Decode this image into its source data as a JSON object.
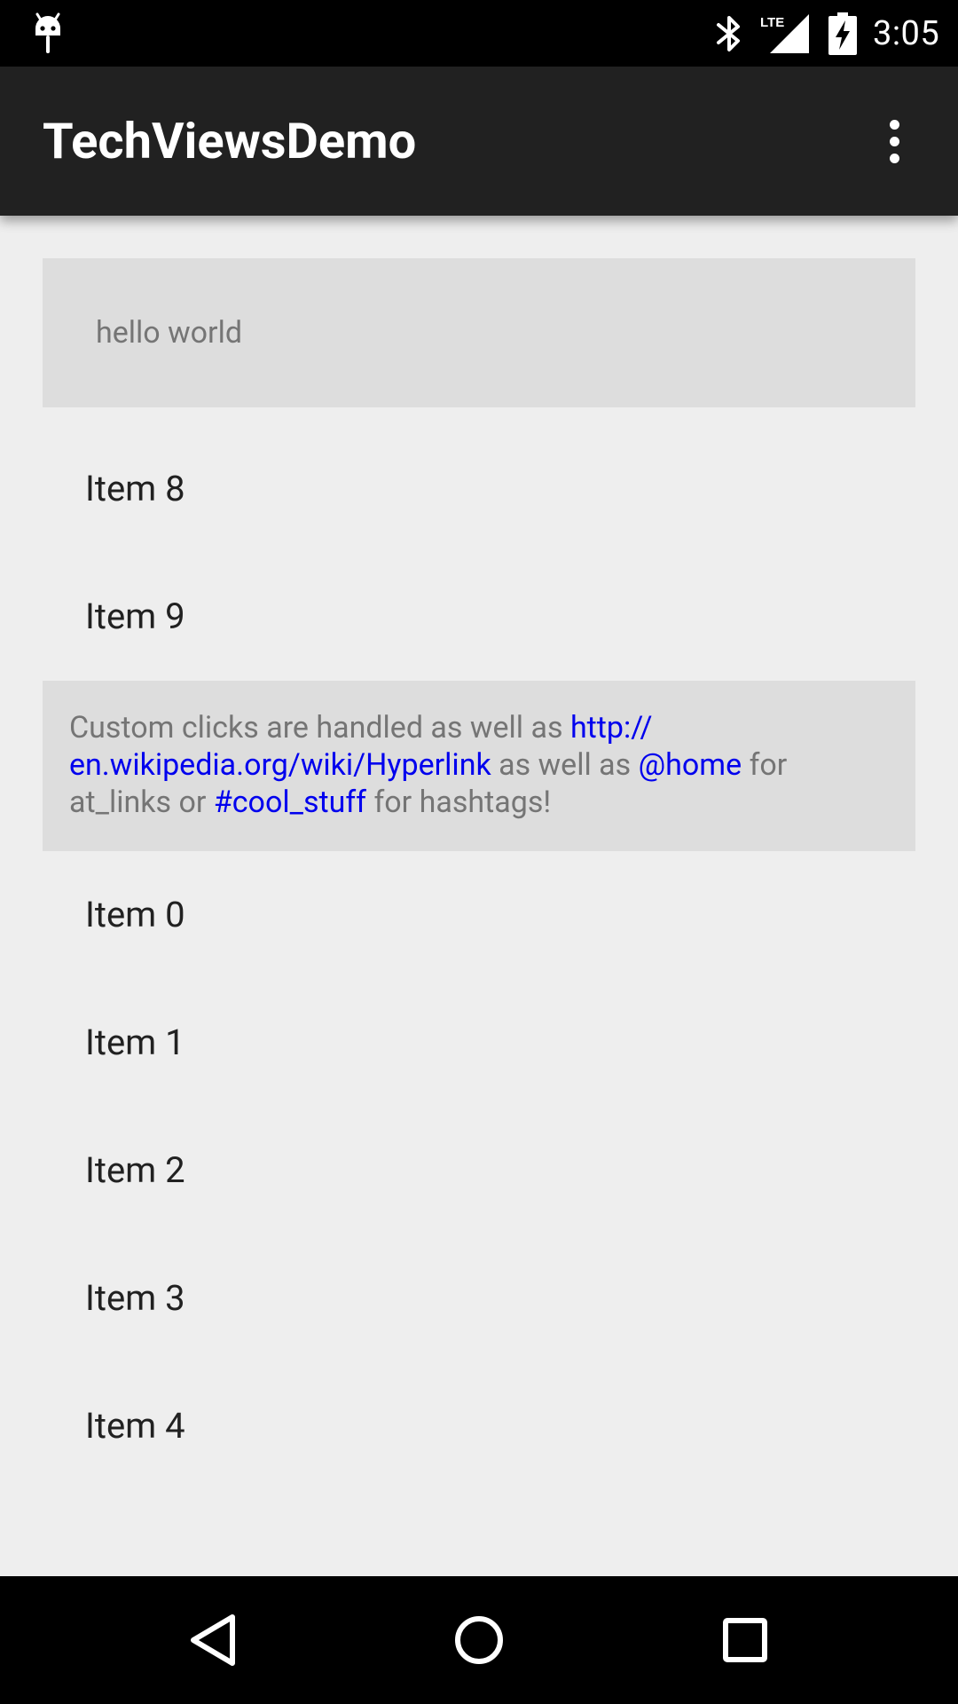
{
  "status_bar": {
    "time": "3:05",
    "network": "LTE",
    "icons": [
      "android-debug-icon",
      "bluetooth-icon",
      "signal-icon",
      "battery-charging-icon"
    ]
  },
  "toolbar": {
    "title": "TechViewsDemo",
    "menu_icon": "overflow-menu-icon"
  },
  "content": {
    "hello_text": "hello world",
    "items_top": [
      "Item 8",
      "Item 9"
    ],
    "link_text": {
      "p1": "Custom clicks are handled as well as ",
      "url_line1": "http://",
      "url_line2": "en.wikipedia.org/wiki/Hyperlink",
      "p2": " as well as ",
      "mention": "@home",
      "p3": " for at_links or ",
      "hashtag": "#cool_stuff",
      "p4": " for hashtags!"
    },
    "items_bottom": [
      "Item 0",
      "Item 1",
      "Item 2",
      "Item 3",
      "Item 4"
    ]
  },
  "colors": {
    "toolbar": "#212121",
    "background": "#eeeeee",
    "card": "#dddddd",
    "link": "#0000ee"
  },
  "nav_bar": {
    "icons": [
      "back-icon",
      "home-icon",
      "recents-icon"
    ]
  }
}
